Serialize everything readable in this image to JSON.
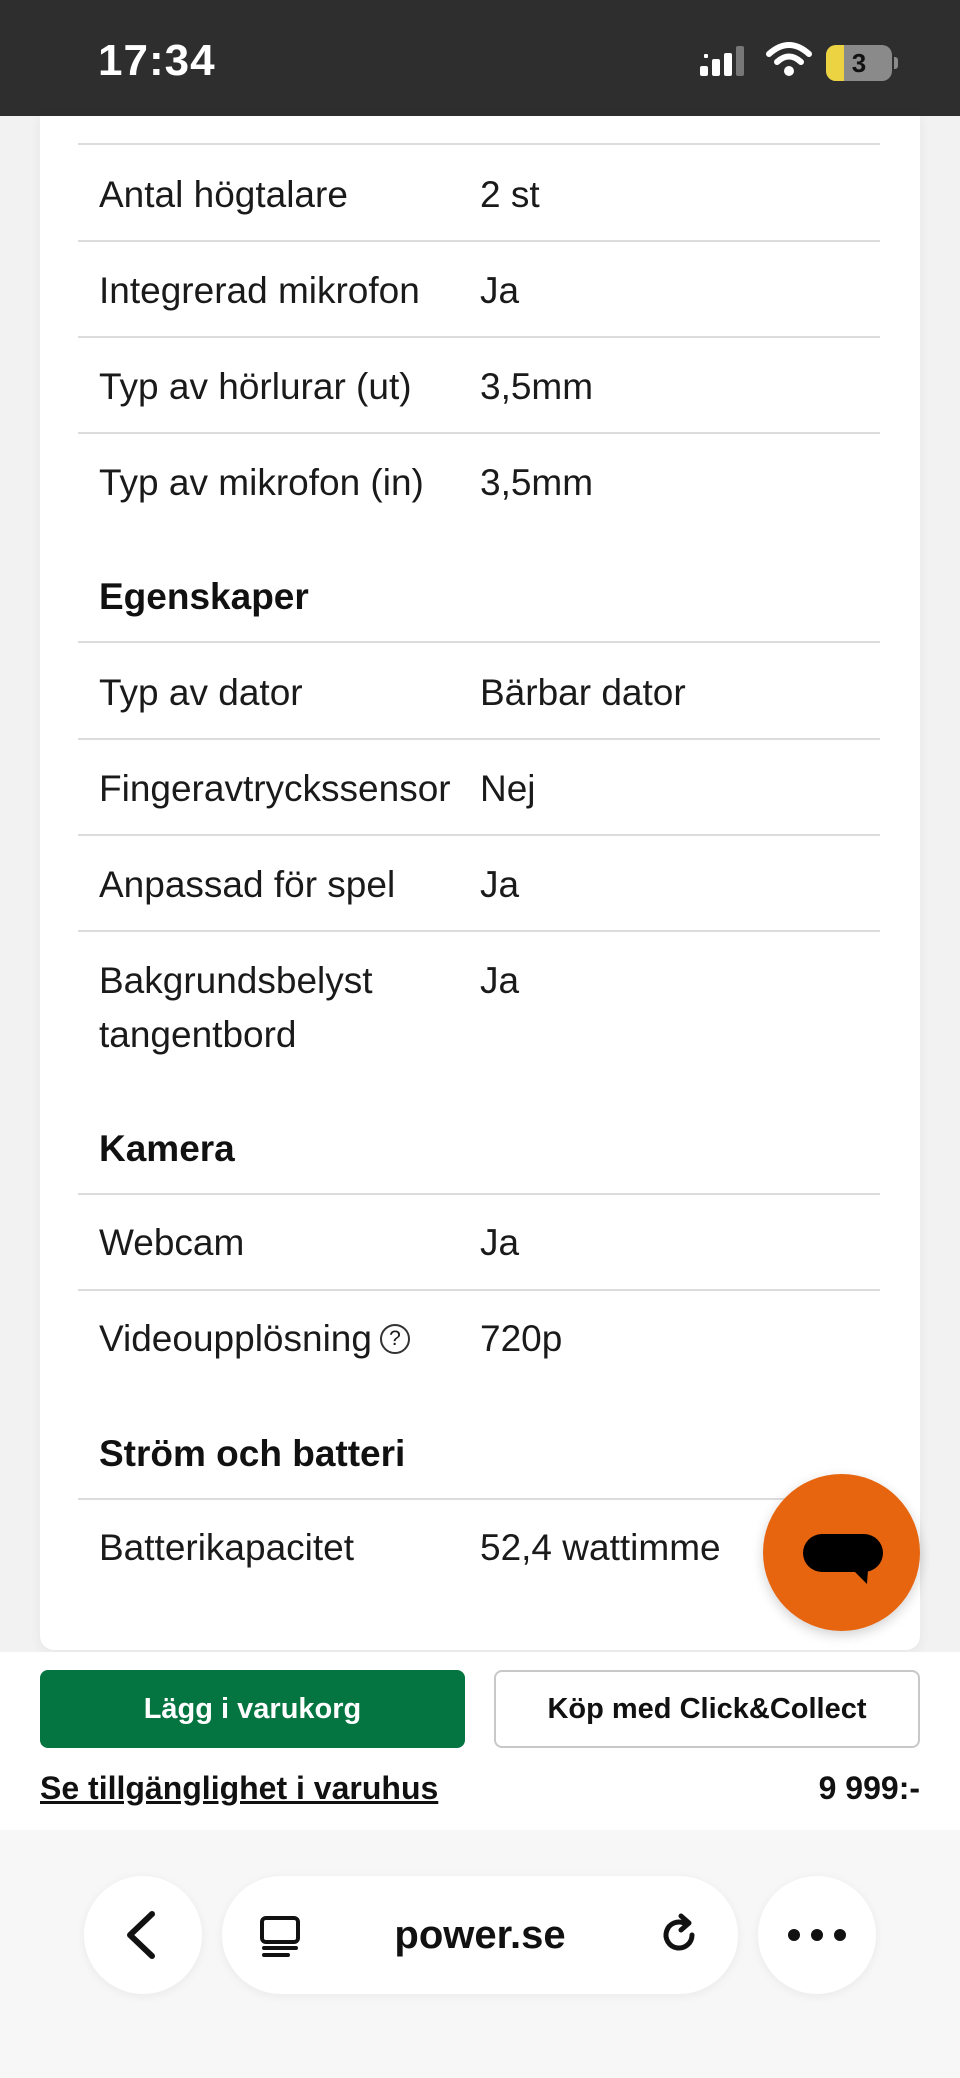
{
  "status_bar": {
    "time": "17:34",
    "battery_level": "3"
  },
  "specs": {
    "rows_top": [
      {
        "label": "Antal högtalare",
        "value": "2 st"
      },
      {
        "label": "Integrerad mikrofon",
        "value": "Ja"
      },
      {
        "label": "Typ av hörlurar (ut)",
        "value": "3,5mm"
      },
      {
        "label": "Typ av mikrofon (in)",
        "value": "3,5mm"
      }
    ],
    "egenskaper": {
      "title": "Egenskaper",
      "rows": [
        {
          "label": "Typ av dator",
          "value": "Bärbar dator"
        },
        {
          "label": "Fingeravtryckssensor",
          "value": "Nej"
        },
        {
          "label": "Anpassad för spel",
          "value": "Ja"
        },
        {
          "label": "Bakgrundsbelyst tangentbord",
          "value": "Ja"
        }
      ]
    },
    "kamera": {
      "title": "Kamera",
      "rows": [
        {
          "label": "Webcam",
          "value": "Ja"
        },
        {
          "label": "Videoupplösning",
          "value": "720p",
          "help": "?"
        }
      ]
    },
    "strom": {
      "title": "Ström och batteri",
      "rows": [
        {
          "label": "Batterikapacitet",
          "value": "52,4 wattimme"
        }
      ]
    }
  },
  "actions": {
    "add_to_cart": "Lägg i varukorg",
    "click_collect": "Köp med Click&Collect",
    "availability_link": "Se tillgänglighet i varuhus",
    "price": "9 999:-"
  },
  "browser": {
    "url": "power.se"
  },
  "colors": {
    "primary_green": "#047540",
    "chat_orange": "#e8650f",
    "status_bar_bg": "#2e2e2e"
  },
  "icons": [
    "signal-icon",
    "wifi-icon",
    "battery-icon",
    "help-icon",
    "chat-icon",
    "back-icon",
    "reader-icon",
    "reload-icon",
    "more-icon"
  ]
}
